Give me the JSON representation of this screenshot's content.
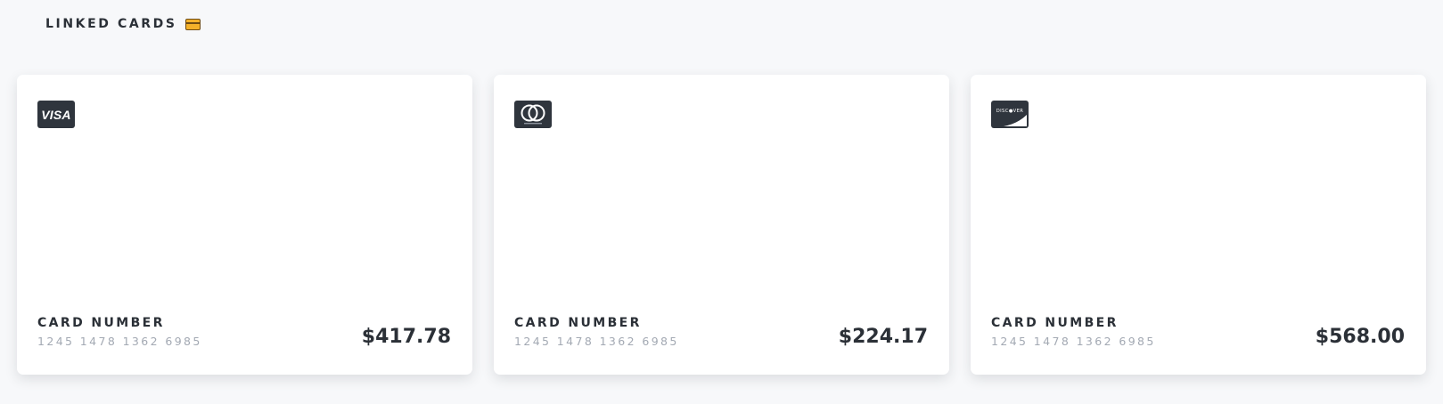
{
  "header": {
    "title": "LINKED CARDS",
    "icon": "credit-card-icon"
  },
  "cards": [
    {
      "brand": "VISA",
      "brand_icon": "visa-icon",
      "label": "CARD NUMBER",
      "number": "1245 1478 1362 6985",
      "amount": "$417.78"
    },
    {
      "brand": "mastercard",
      "brand_icon": "mastercard-icon",
      "label": "CARD NUMBER",
      "number": "1245 1478 1362 6985",
      "amount": "$224.17"
    },
    {
      "brand": "DISCOVER",
      "brand_icon": "discover-icon",
      "label": "CARD NUMBER",
      "number": "1245 1478 1362 6985",
      "amount": "$568.00"
    }
  ],
  "colors": {
    "background": "#f7f8fa",
    "card": "#ffffff",
    "text": "#2b3037",
    "muted": "#a3a9b3",
    "logo_bg": "#2f353d"
  }
}
